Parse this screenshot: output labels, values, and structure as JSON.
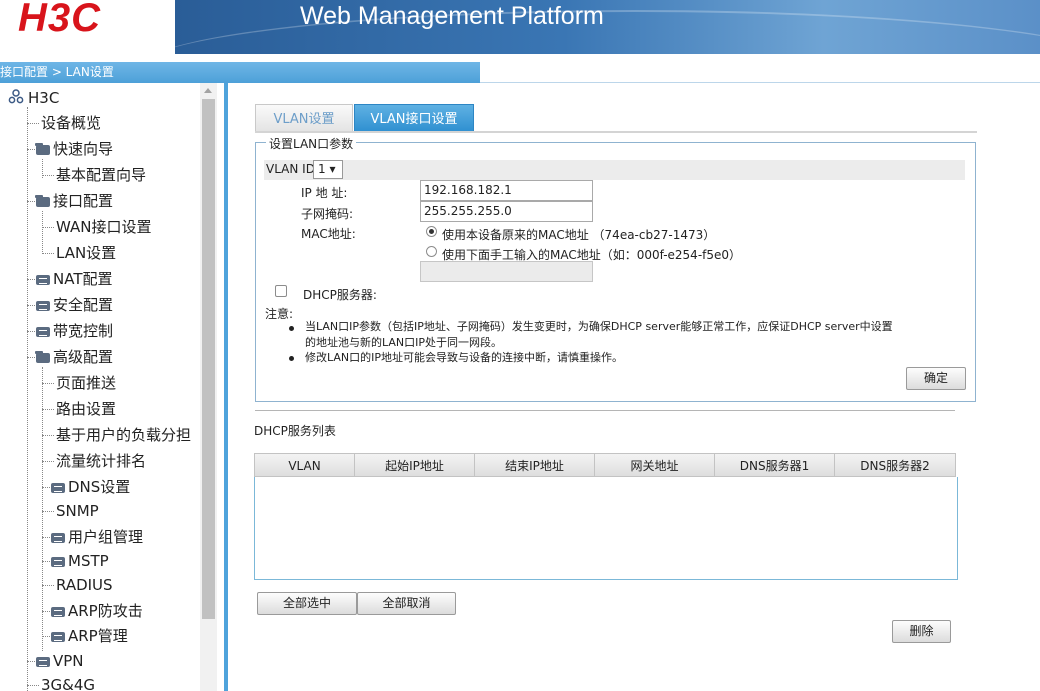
{
  "header": {
    "logo_text": "H3C",
    "platform_title": "Web Management Platform",
    "logo_color": "#d8141b"
  },
  "breadcrumb": "接口配置 > LAN设置",
  "sidebar": {
    "root": "H3C",
    "items": [
      {
        "label": "设备概览"
      },
      {
        "label": "快速向导"
      },
      {
        "label": "基本配置向导"
      },
      {
        "label": "接口配置"
      },
      {
        "label": "WAN接口设置"
      },
      {
        "label": "LAN设置"
      },
      {
        "label": "NAT配置"
      },
      {
        "label": "安全配置"
      },
      {
        "label": "带宽控制"
      },
      {
        "label": "高级配置"
      },
      {
        "label": "页面推送"
      },
      {
        "label": "路由设置"
      },
      {
        "label": "基于用户的负载分担"
      },
      {
        "label": "流量统计排名"
      },
      {
        "label": "DNS设置"
      },
      {
        "label": "SNMP"
      },
      {
        "label": "用户组管理"
      },
      {
        "label": "MSTP"
      },
      {
        "label": "RADIUS"
      },
      {
        "label": "ARP防攻击"
      },
      {
        "label": "ARP管理"
      },
      {
        "label": "VPN"
      },
      {
        "label": "3G&4G"
      }
    ]
  },
  "tabs": [
    {
      "label": "VLAN设置"
    },
    {
      "label": "VLAN接口设置"
    }
  ],
  "form": {
    "legend": "设置LAN口参数",
    "vlan_id_label": "VLAN ID",
    "vlan_id_value": "1 ▾",
    "ip_label": "IP 地 址:",
    "ip_value": "192.168.182.1",
    "mask_label": "子网掩码:",
    "mask_value": "255.255.255.0",
    "mac_label": "MAC地址:",
    "mac_option_1": "使用本设备原来的MAC地址 （74ea-cb27-1473）",
    "mac_option_2": "使用下面手工输入的MAC地址（如：000f-e254-f5e0）",
    "mac_manual_value": "",
    "dhcp_label": "DHCP服务器:",
    "note_label": "注意:",
    "note_1": "当LAN口IP参数（包括IP地址、子网掩码）发生变更时，为确保DHCP server能够正常工作，应保证DHCP server中设置",
    "note_1b": "的地址池与新的LAN口IP处于同一网段。",
    "note_2": "修改LAN口的IP地址可能会导致与设备的连接中断，请慎重操作。",
    "confirm_button": "确定"
  },
  "dhcp_list": {
    "title": "DHCP服务列表",
    "columns": [
      "VLAN",
      "起始IP地址",
      "结束IP地址",
      "网关地址",
      "DNS服务器1",
      "DNS服务器2"
    ],
    "rows": []
  },
  "buttons": {
    "select_all": "全部选中",
    "deselect_all": "全部取消",
    "delete": "删除"
  }
}
